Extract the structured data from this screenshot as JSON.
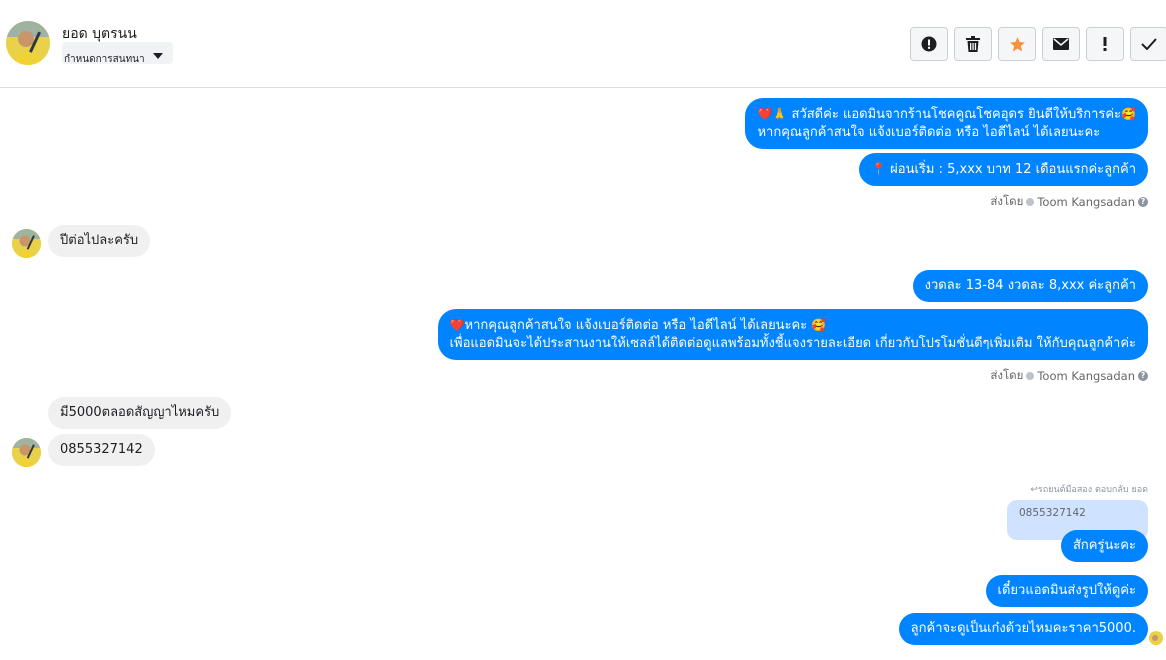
{
  "header": {
    "contact_name": "ยอด บุตรนน",
    "conversation_action": "กำหนดการสนทนา"
  },
  "toolbar": {
    "buttons": [
      {
        "name": "alert-icon"
      },
      {
        "name": "trash-icon"
      },
      {
        "name": "star-icon"
      },
      {
        "name": "envelope-icon"
      },
      {
        "name": "exclamation-icon"
      },
      {
        "name": "checkmark-icon"
      }
    ]
  },
  "messages": {
    "out1_line1": "สวัสดีค่ะ แอดมินจากร้านโชคคูณโชคอุดร ยินดีให้บริการค่ะ",
    "out1_line2": "หากคุณลูกค้าสนใจ แจ้งเบอร์ติดต่อ หรือ ไอดีไลน์ ได้เลยนะคะ",
    "out2": "ผ่อนเริ่ม : 5,xxx บาท 12 เดือนแรกค่ะลูกค้า",
    "sent_by_1": "ส่งโดย",
    "agent_1": "Toom Kangsadan",
    "in1": "ปีต่อไปละครับ",
    "out3": "งวดละ 13-84 งวดละ 8,xxx ค่ะลูกค้า",
    "out4_line1": "หากคุณลูกค้าสนใจ แจ้งเบอร์ติดต่อ หรือ ไอดีไลน์ ได้เลยนะคะ",
    "out4_line2": "เพื่อแอดมินจะได้ประสานงานให้เซลล์ได้ติดต่อดูแลพร้อมทั้งชี้แจงรายละเอียด เกี่ยวกับโปรโมชั่นดีๆเพิ่มเติม ให้กับคุณลูกค้าค่ะ",
    "sent_by_2": "ส่งโดย",
    "agent_2": "Toom Kangsadan",
    "in2": "มี5000ตลอดสัญญาไหมครับ",
    "in3": "0855327142",
    "reply_label": "รถยนต์มือสอง ตอบกลับ ยอด",
    "quoted_text": "0855327142",
    "out5": "สักครู่นะคะ",
    "out6": "เดี๋ยวแอดมินส่งรูปให้ดูค่ะ",
    "out7": "ลูกค้าจะดูเป็นเก๋งด้วยไหมคะราคา5000."
  },
  "emojis": {
    "heart": "❤️",
    "pray": "🙏",
    "smile_hearts": "🥰",
    "pin": "📍"
  },
  "colors": {
    "outgoing_bubble": "#0084ff",
    "incoming_bubble": "#f0f0f0",
    "star": "#f7923a"
  }
}
